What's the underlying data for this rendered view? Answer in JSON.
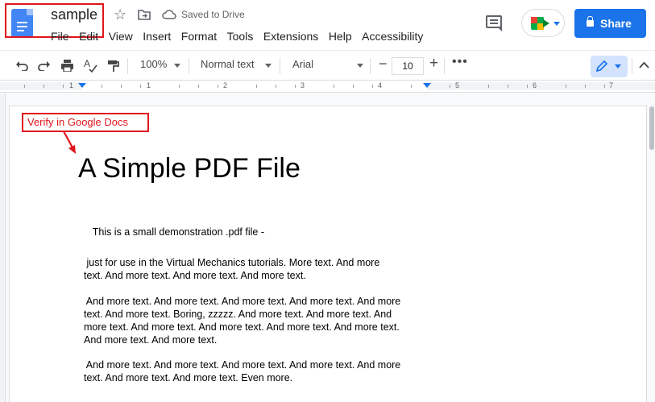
{
  "header": {
    "doc_title": "sample",
    "saved_status": "Saved to Drive",
    "share_label": "Share",
    "menu": [
      "File",
      "Edit",
      "View",
      "Insert",
      "Format",
      "Tools",
      "Extensions",
      "Help",
      "Accessibility"
    ]
  },
  "toolbar": {
    "zoom": "100%",
    "style": "Normal text",
    "font": "Arial",
    "font_size": "10"
  },
  "ruler": {
    "numbers": [
      "1",
      "1",
      "2",
      "3",
      "4",
      "5",
      "6",
      "7"
    ]
  },
  "annotation": {
    "label": "Verify in Google Docs"
  },
  "document": {
    "heading": "A Simple PDF File",
    "paragraphs": [
      [
        "  This is a small demonstration .pdf file -"
      ],
      [
        " just for use in the Virtual Mechanics tutorials. More text. And more",
        "text. And more text. And more text. And more text."
      ],
      [
        " And more text. And more text. And more text. And more text. And more",
        "text. And more text. Boring, zzzzz. And more text. And more text. And",
        "more text. And more text. And more text. And more text. And more text.",
        "And more text. And more text."
      ],
      [
        " And more text. And more text. And more text. And more text. And more",
        "text. And more text. And more text. Even more."
      ]
    ]
  },
  "colors": {
    "accent": "#1a73e8",
    "annotation_red": "#e0161c"
  }
}
